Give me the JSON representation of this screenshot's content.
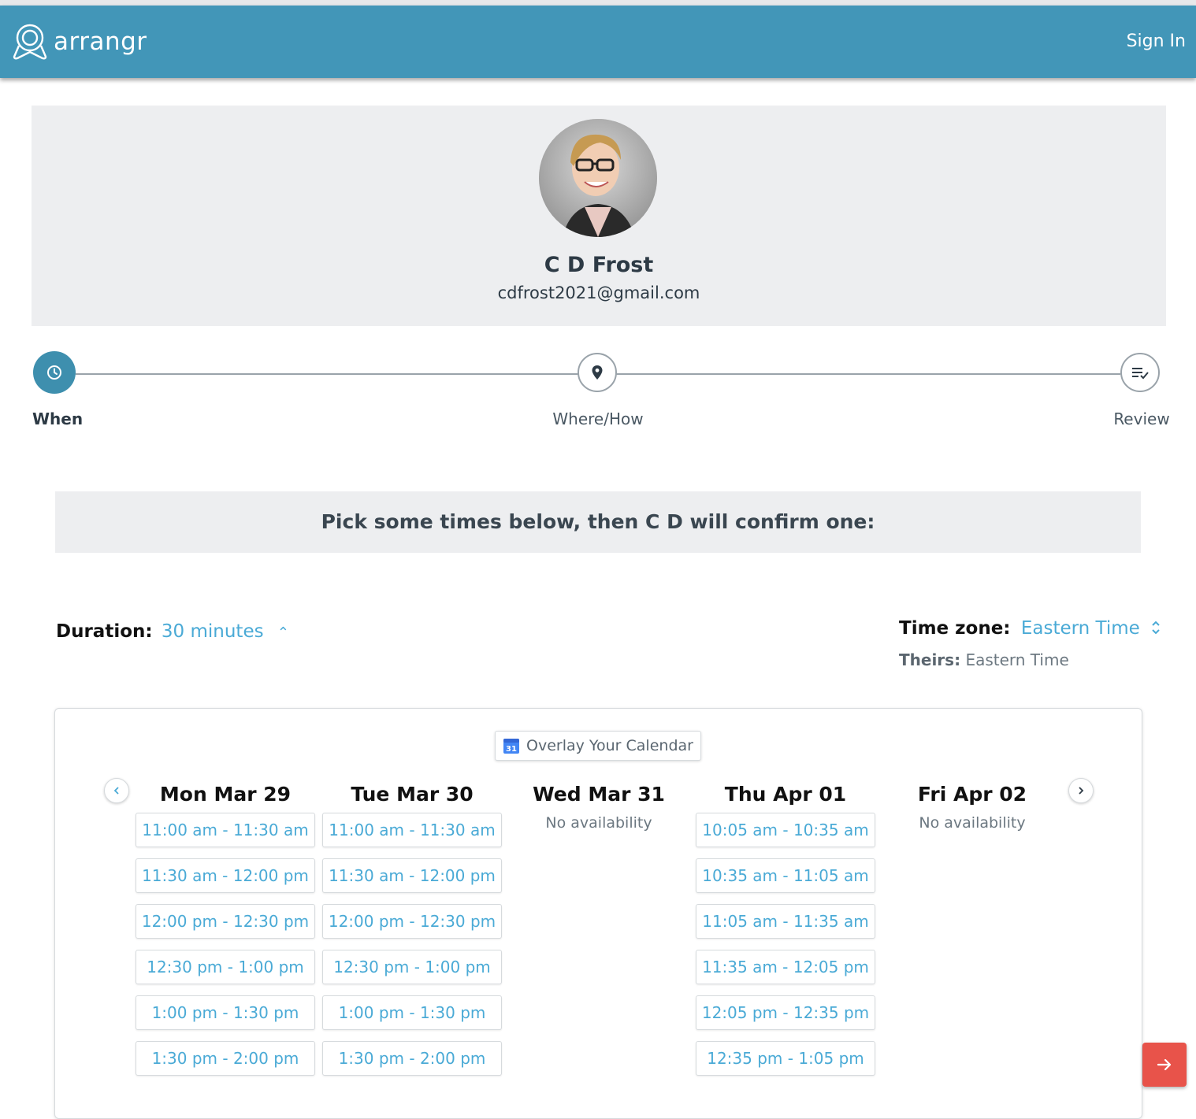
{
  "header": {
    "brand": "arrangr",
    "sign_in": "Sign In",
    "colors": {
      "bar": "#4296b8",
      "accent": "#4aaad6",
      "cta": "#e8534a"
    }
  },
  "profile": {
    "name": "C D Frost",
    "email": "cdfrost2021@gmail.com"
  },
  "steps": [
    {
      "label": "When",
      "icon": "clock-icon",
      "active": true
    },
    {
      "label": "Where/How",
      "icon": "location-pin-icon",
      "active": false
    },
    {
      "label": "Review",
      "icon": "checklist-icon",
      "active": false
    }
  ],
  "banner": "Pick some times below, then C D will confirm one:",
  "duration": {
    "label": "Duration:",
    "value": "30 minutes"
  },
  "timezone": {
    "label": "Time zone:",
    "value": "Eastern Time",
    "theirs_label": "Theirs:",
    "theirs_value": "Eastern Time"
  },
  "calendar": {
    "overlay_label": "Overlay Your Calendar",
    "days": [
      {
        "title": "Mon Mar 29",
        "slots": [
          "11:00 am - 11:30 am",
          "11:30 am - 12:00 pm",
          "12:00 pm - 12:30 pm",
          "12:30 pm - 1:00 pm",
          "1:00 pm - 1:30 pm",
          "1:30 pm - 2:00 pm"
        ]
      },
      {
        "title": "Tue Mar 30",
        "slots": [
          "11:00 am - 11:30 am",
          "11:30 am - 12:00 pm",
          "12:00 pm - 12:30 pm",
          "12:30 pm - 1:00 pm",
          "1:00 pm - 1:30 pm",
          "1:30 pm - 2:00 pm"
        ]
      },
      {
        "title": "Wed Mar 31",
        "no_availability": "No availability"
      },
      {
        "title": "Thu Apr 01",
        "slots": [
          "10:05 am - 10:35 am",
          "10:35 am - 11:05 am",
          "11:05 am - 11:35 am",
          "11:35 am - 12:05 pm",
          "12:05 pm - 12:35 pm",
          "12:35 pm - 1:05 pm"
        ]
      },
      {
        "title": "Fri Apr 02",
        "no_availability": "No availability"
      }
    ]
  }
}
